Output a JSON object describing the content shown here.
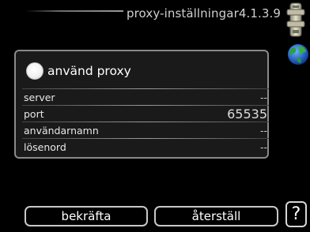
{
  "header": {
    "title": "proxy-inställningar4.1.3.9",
    "device_icon": "thermostat-device-icon",
    "network_icon": "globe-icon"
  },
  "proxy": {
    "toggle_label": "använd proxy",
    "enabled": false
  },
  "fields": [
    {
      "label": "server",
      "value": "--"
    },
    {
      "label": "port",
      "value": "65535"
    },
    {
      "label": "användarnamn",
      "value": "--"
    },
    {
      "label": "lösenord",
      "value": "--"
    }
  ],
  "actions": {
    "confirm_label": "bekräfta",
    "reset_label": "återställ",
    "help_label": "?"
  },
  "colors": {
    "background": "#000000",
    "panel": "#1a1a1a",
    "border": "#8a8a8a",
    "text": "#ffffff"
  }
}
